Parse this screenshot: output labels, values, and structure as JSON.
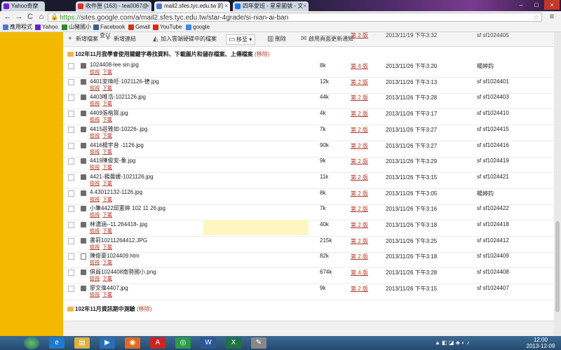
{
  "tabs": [
    {
      "label": "Yahoo奇摩",
      "fav_color": "#6d1ed4"
    },
    {
      "label": "收件匣 (163) - tea0067@",
      "fav_color": "#d93025"
    },
    {
      "label": "mail2.sfes.tyc.edu.tw 的",
      "fav_color": "#4a7bd0"
    },
    {
      "label": "四年愛班 - 星星圖號 - 文",
      "fav_color": "#1a73e8"
    }
  ],
  "toolbar": {
    "back": "←",
    "forward": "→",
    "reload": "C",
    "home": "⌂",
    "url_scheme": "https://",
    "url_rest": "sites.google.com/a/mail2.sfes.tyc.edu.tw/star-4grade/si-nian-ai-ban"
  },
  "bookmarks": [
    {
      "label": "應用程式",
      "color": "#4a7bd0"
    },
    {
      "label": "Yahoo",
      "color": "#6d1ed4"
    },
    {
      "label": "山豬國小",
      "color": "#2a8a2a"
    },
    {
      "label": "Facebook",
      "color": "#3b5998"
    },
    {
      "label": "Gmail",
      "color": "#d93025"
    },
    {
      "label": "YouTube",
      "color": "#e62117"
    },
    {
      "label": "google",
      "color": "#4285f4"
    }
  ],
  "cabinet_bar": {
    "add_file": "新增檔案",
    "add_link": "新增連結",
    "add_drive": "加入雲端硬碟中的檔案",
    "move_to": "移至",
    "delete": "刪除",
    "notify": "啟用頁面更新通知",
    "top_row": {
      "partial_name": "查以",
      "version": "第 2 版",
      "date": "2013/11/19 下午3:32",
      "user": "sf sf1024405"
    }
  },
  "sections": [
    {
      "title": "102年11月我學會使用關鍵字尋找資料、下載圖片和儲存檔案、上傳檔案",
      "remove": "(移除)"
    },
    {
      "title": "102年11月資訊期中測驗",
      "remove": "(移除)"
    }
  ],
  "file_links": {
    "view": "檢視",
    "download": "下載"
  },
  "files": [
    {
      "name": "1024408-lee sin.jpg",
      "size": "8k",
      "version": "第 4 版",
      "date": "2013/11/26 下午3:20",
      "user": "楊婷鈞",
      "type": "img"
    },
    {
      "name": "4401安喚旺-1021126-德.jpg",
      "size": "12k",
      "version": "第 2 版",
      "date": "2013/11/26 下午3:13",
      "user": "sf sf1024401",
      "type": "img"
    },
    {
      "name": "4403唯浩-1021126.jpg",
      "size": "44k",
      "version": "第 2 版",
      "date": "2013/11/26 下午3:28",
      "user": "sf sf1024403",
      "type": "img"
    },
    {
      "name": "4409張楷賀.jpg",
      "size": "4k",
      "version": "第 2 版",
      "date": "2013/11/26 下午3:17",
      "user": "sf sf1024410",
      "type": "img"
    },
    {
      "name": "4415莊雅如-10226-.jpg",
      "size": "7k",
      "version": "第 2 版",
      "date": "2013/11/26 下午3:27",
      "user": "sf sf1024415",
      "type": "img"
    },
    {
      "name": "4416楊宇音 -1126.jpg",
      "size": "90k",
      "version": "第 2 版",
      "date": "2013/11/26 下午3:27",
      "user": "sf sf1024416",
      "type": "img"
    },
    {
      "name": "4419陳俊安-象.jpg",
      "size": "9k",
      "version": "第 2 版",
      "date": "2013/11/26 下午3:29",
      "user": "sf sf1024419",
      "type": "img"
    },
    {
      "name": "4421-楊晨媛-1021126.jpg",
      "size": "11k",
      "version": "第 2 版",
      "date": "2013/11/26 下午3:15",
      "user": "sf sf1024421",
      "type": "img"
    },
    {
      "name": "4.43012132-1126.jpg",
      "size": "8k",
      "version": "第 2 版",
      "date": "2013/11/26 下午3:05",
      "user": "楊婷鈞",
      "type": "img"
    },
    {
      "name": "小筆4422邱憲婷 102 11 26.jpg",
      "size": "7k",
      "version": "第 2 版",
      "date": "2013/11/26 下午3:16",
      "user": "sf sf1024422",
      "type": "img"
    },
    {
      "name": "林濃涵--11.264418-.jpg",
      "size": "40k",
      "version": "第 2 版",
      "date": "2013/11/26 下午3:18",
      "user": "sf sf1024418",
      "type": "img",
      "highlight": true
    },
    {
      "name": "書莉10211264412.JPG",
      "size": "215k",
      "version": "第 2 版",
      "date": "2013/11/26 下午3:25",
      "user": "sf sf1024412",
      "type": "img"
    },
    {
      "name": "陳俊豪1024409.htm",
      "size": "82k",
      "version": "第 2 版",
      "date": "2013/11/26 下午3:18",
      "user": "sf sf1024409",
      "type": "doc"
    },
    {
      "name": "俱員1024408南勢國小.png",
      "size": "674k",
      "version": "第 4 版",
      "date": "2013/11/26 下午3:28",
      "user": "sf sf1024408",
      "type": "img"
    },
    {
      "name": "廖文偉4407.jpg",
      "size": "9k",
      "version": "第 2 版",
      "date": "2013/11/26 下午3:15",
      "user": "sf sf1024407",
      "type": "img"
    }
  ],
  "taskbar": {
    "apps": [
      {
        "icon": "ie-icon",
        "glyph": "e",
        "color": "#1f7acc"
      },
      {
        "icon": "folder-icon",
        "glyph": "▤",
        "color": "#e0b040"
      },
      {
        "icon": "media-icon",
        "glyph": "▶",
        "color": "#2a6fb3"
      },
      {
        "icon": "firefox-icon",
        "glyph": "◉",
        "color": "#e06b1f"
      },
      {
        "icon": "acrobat-icon",
        "glyph": "A",
        "color": "#c22"
      },
      {
        "icon": "chrome-icon",
        "glyph": "◎",
        "color": "#2b9b4a"
      },
      {
        "icon": "word-icon",
        "glyph": "W",
        "color": "#2b5797"
      },
      {
        "icon": "excel-icon",
        "glyph": "X",
        "color": "#1e7145"
      },
      {
        "icon": "paint-icon",
        "glyph": "✎",
        "color": "#888"
      }
    ],
    "time": "12:00",
    "date": "2013-12-09"
  }
}
